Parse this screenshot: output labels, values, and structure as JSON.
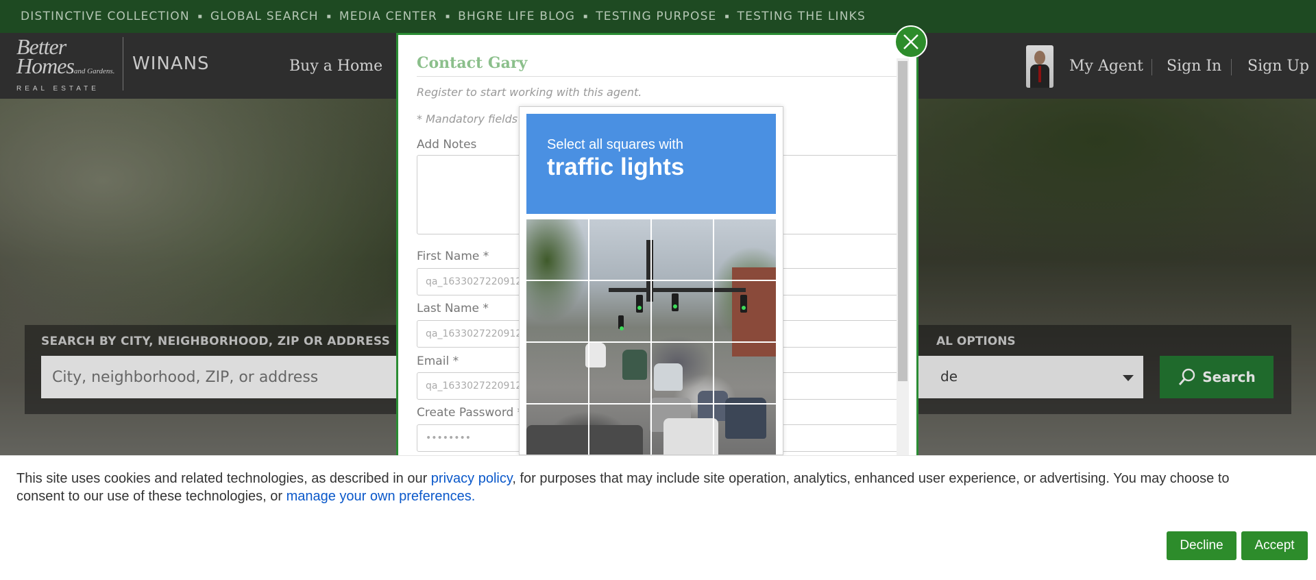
{
  "topnav": {
    "items": [
      "DISTINCTIVE COLLECTION",
      "GLOBAL SEARCH",
      "MEDIA CENTER",
      "BHGRE LIFE BLOG",
      "TESTING PURPOSE",
      "TESTING THE LINKS"
    ]
  },
  "header": {
    "logo_line1": "Better",
    "logo_line2": "Homes",
    "logo_line2b": "and Gardens.",
    "logo_line3": "REAL ESTATE",
    "brand": "WINANS",
    "nav_buy": "Buy a Home",
    "my_agent": "My Agent",
    "sign_in": "Sign In",
    "sign_up": "Sign Up"
  },
  "search": {
    "label": "SEARCH BY CITY, NEIGHBORHOOD, ZIP OR ADDRESS",
    "placeholder": "City, neighborhood, ZIP, or address",
    "options_label": "AL OPTIONS",
    "select_value": "de",
    "button": "Search"
  },
  "modal": {
    "title": "Contact Gary",
    "subtitle": "Register to start working with this agent.",
    "mandatory": "* Mandatory fields",
    "notes_label": "Add Notes",
    "first_name_label": "First Name *",
    "first_name_value": "qa_1633027220912",
    "last_name_label": "Last Name *",
    "last_name_value": "qa_1633027220912",
    "email_label": "Email *",
    "email_value": "qa_1633027220912",
    "password_label": "Create Password *",
    "password_value": "••••••••"
  },
  "captcha": {
    "instruction": "Select all squares with",
    "target": "traffic lights"
  },
  "cookie": {
    "text1": "This site uses cookies and related technologies, as described in our ",
    "link1": "privacy policy",
    "text2": ", for purposes that may include site operation, analytics, enhanced user experience, or advertising. You may choose to",
    "text3": "consent to our use of these technologies, or ",
    "link2": "manage your own preferences.",
    "decline": "Decline",
    "accept": "Accept"
  },
  "colors": {
    "brand_green": "#2d8c2b",
    "topbar_green": "#1e4a22",
    "captcha_blue": "#4a90e2",
    "link_blue": "#0a58ca"
  }
}
